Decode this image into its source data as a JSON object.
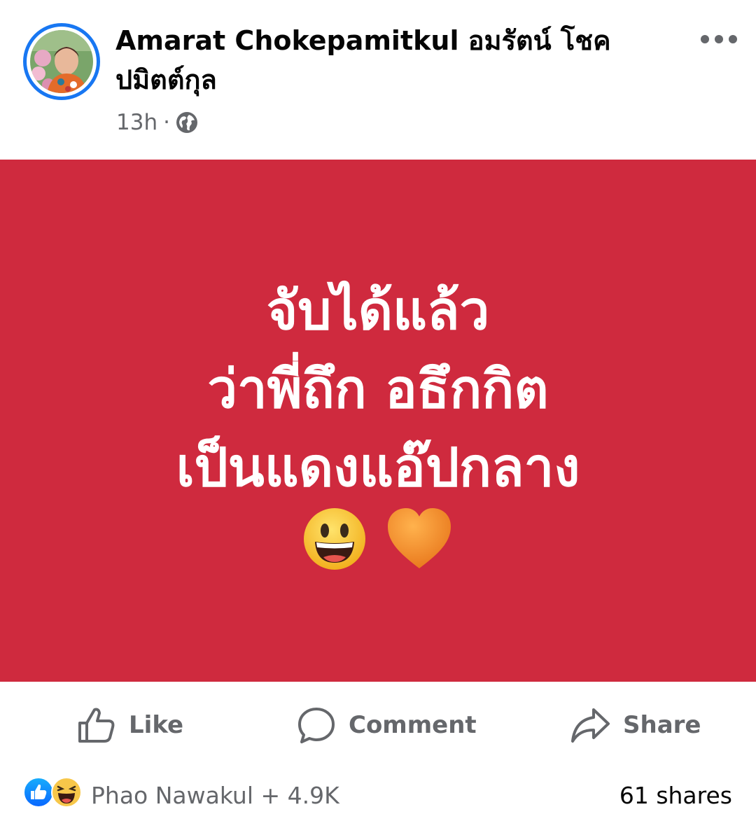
{
  "header": {
    "author_name": "Amarat Chokepamitkul อมรัตน์ โชคปมิตต์กุล",
    "time": "13h",
    "separator": "·",
    "privacy_icon": "globe-icon",
    "more_icon": "more-dots-icon"
  },
  "post": {
    "background_color": "#cf2a3e",
    "lines": [
      "จับได้แล้ว",
      "ว่าพี่ถึก อธึกกิต",
      "เป็นแดงแอ๊ปกลาง"
    ],
    "emojis": [
      "grinning-face-emoji",
      "orange-heart-emoji"
    ]
  },
  "actions": {
    "like_label": "Like",
    "comment_label": "Comment",
    "share_label": "Share"
  },
  "footer": {
    "reaction_icons": [
      "like-reaction-icon",
      "haha-reaction-icon"
    ],
    "reactions_text": "Phao Nawakul + 4.9K",
    "shares_text": "61 shares"
  }
}
